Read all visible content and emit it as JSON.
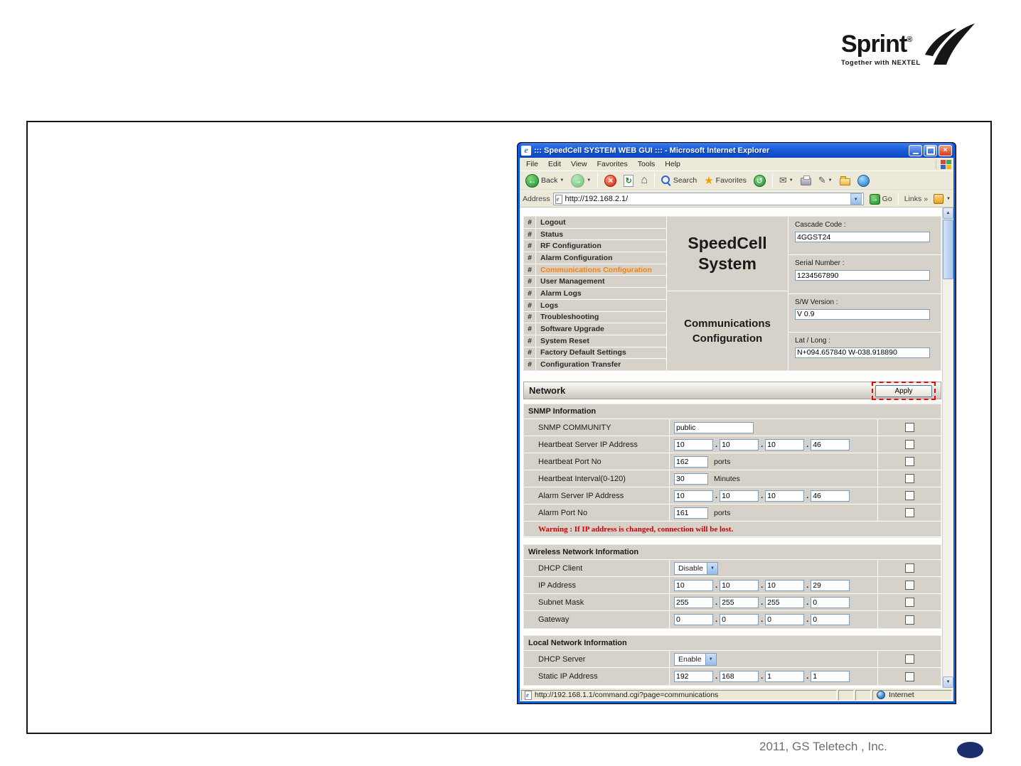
{
  "logo": {
    "brand": "Sprint",
    "reg": "®",
    "tagline": "Together with NEXTEL"
  },
  "footer": {
    "copyright": "2011, GS Teletech , Inc."
  },
  "colors": {
    "accent_orange": "#ff8000",
    "warning_red": "#cc0000",
    "titlebar_blue": "#0c59d8",
    "annotation_red": "#ee0000",
    "oval_navy": "#1b2f6e"
  },
  "icons": {
    "back_arrow": "←",
    "forward_arrow": "→",
    "stop": "×",
    "refresh": "↻",
    "home": "⌂",
    "favorites_star": "★",
    "history": "↺",
    "mail": "✉",
    "edit": "✎",
    "dropdown_arrow": "▼",
    "go_arrow": "→",
    "links_chevron": "»",
    "close": "×",
    "scroll_up": "▲",
    "scroll_down": "▼"
  },
  "browser": {
    "title": "::: SpeedCell SYSTEM WEB GUI ::: - Microsoft Internet Explorer",
    "menu": [
      "File",
      "Edit",
      "View",
      "Favorites",
      "Tools",
      "Help"
    ],
    "toolbar": {
      "back": "Back",
      "search": "Search",
      "favorites": "Favorites"
    },
    "address": {
      "label": "Address",
      "url": "http://192.168.2.1/",
      "go": "Go",
      "links": "Links"
    },
    "status": {
      "url": "http://192.168.1.1/command.cgi?page=communications",
      "zone": "Internet"
    }
  },
  "app": {
    "nav_bullet": "#",
    "nav": [
      {
        "label": "Logout",
        "active": false
      },
      {
        "label": "Status",
        "active": false
      },
      {
        "label": "RF Configuration",
        "active": false
      },
      {
        "label": "Alarm Configuration",
        "active": false
      },
      {
        "label": "Communications Configuration",
        "active": true
      },
      {
        "label": "User Management",
        "active": false
      },
      {
        "label": "Alarm Logs",
        "active": false
      },
      {
        "label": "Logs",
        "active": false
      },
      {
        "label": "Troubleshooting",
        "active": false
      },
      {
        "label": "Software Upgrade",
        "active": false
      },
      {
        "label": "System Reset",
        "active": false
      },
      {
        "label": "Factory Default Settings",
        "active": false
      },
      {
        "label": "Configuration Transfer",
        "active": false
      }
    ],
    "system_title": "SpeedCell\nSystem",
    "page_title": "Communications\nConfiguration",
    "info_fields": [
      {
        "label": "Cascade Code :",
        "value": "4GGST24"
      },
      {
        "label": "Serial Number :",
        "value": "1234567890"
      },
      {
        "label": "S/W Version :",
        "value": "V 0.9"
      },
      {
        "label": "Lat / Long :",
        "value": "N+094.657840 W-038.918890"
      }
    ],
    "network": {
      "title": "Network",
      "apply": "Apply"
    },
    "form": {
      "ip_separator": ".",
      "sections": [
        {
          "title": "SNMP Information",
          "rows": [
            {
              "label": "SNMP COMMUNITY",
              "type": "text",
              "value": "public"
            },
            {
              "label": "Heartbeat Server IP Address",
              "type": "ip",
              "value": [
                "10",
                "10",
                "10",
                "46"
              ]
            },
            {
              "label": "Heartbeat Port No",
              "type": "unit",
              "value": "162",
              "unit": "ports"
            },
            {
              "label": "Heartbeat Interval(0-120)",
              "type": "unit",
              "value": "30",
              "unit": "Minutes"
            },
            {
              "label": "Alarm Server IP Address",
              "type": "ip",
              "value": [
                "10",
                "10",
                "10",
                "46"
              ]
            },
            {
              "label": "Alarm Port No",
              "type": "unit",
              "value": "161",
              "unit": "ports"
            }
          ],
          "warning": "Warning : If IP address is changed, connection will be lost."
        },
        {
          "title": "Wireless Network Information",
          "rows": [
            {
              "label": "DHCP Client",
              "type": "select",
              "value": "Disable"
            },
            {
              "label": "IP Address",
              "type": "ip",
              "value": [
                "10",
                "10",
                "10",
                "29"
              ]
            },
            {
              "label": "Subnet Mask",
              "type": "ip",
              "value": [
                "255",
                "255",
                "255",
                "0"
              ]
            },
            {
              "label": "Gateway",
              "type": "ip",
              "value": [
                "0",
                "0",
                "0",
                "0"
              ]
            }
          ]
        },
        {
          "title": "Local Network Information",
          "rows": [
            {
              "label": "DHCP Server",
              "type": "select",
              "value": "Enable"
            },
            {
              "label": "Static IP Address",
              "type": "ip",
              "value": [
                "192",
                "168",
                "1",
                "1"
              ]
            }
          ]
        }
      ]
    }
  }
}
